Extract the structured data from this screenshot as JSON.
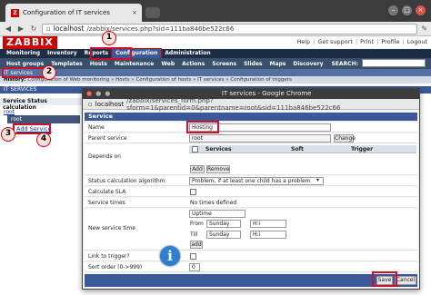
{
  "outer_browser": {
    "tab_title": "Configuration of IT services",
    "url_host": "localhost",
    "url_path": "/zabbix/services.php?sid=111ba846be522c66"
  },
  "zabbix": {
    "logo": "ZABBIX",
    "top_links": [
      "Help",
      "Get support",
      "Print",
      "Profile",
      "Logout"
    ],
    "main_menu": [
      "Monitoring",
      "Inventory",
      "Reports",
      "Configuration",
      "Administration"
    ],
    "sub_menu": [
      "Host groups",
      "Templates",
      "Hosts",
      "Maintenance",
      "Web",
      "Actions",
      "Screens",
      "Slides",
      "Maps",
      "Discovery"
    ],
    "search_label": "SEARCH:",
    "it_services_label": "IT services",
    "history_label": "History:",
    "history_items": [
      "Configuration of Web monitoring",
      "Hosts",
      "Configuration of hosts",
      "IT services",
      "Configuration of triggers"
    ],
    "section_bar": "IT SERVICES",
    "svc_col_header": "Service  Status calculation",
    "root_link": "root",
    "root_row": "root",
    "add_service": "Add Service"
  },
  "popup": {
    "window_title": "IT services - Google Chrome",
    "url_host": "localhost",
    "url_path": "/zabbix/services_form.php?sform=1&parentid=0&parentname=root&sid=111ba846be522c66",
    "header": "Service",
    "fields": {
      "name_label": "Name",
      "name_value": "Hosting",
      "parent_label": "Parent service",
      "parent_value": "root",
      "change_btn": "Change",
      "depends_label": "Depends on",
      "dep_cols": [
        "Services",
        "Soft",
        "Trigger"
      ],
      "add_btn": "Add",
      "remove_btn": "Remove",
      "status_calc_label": "Status calculation algorithm",
      "status_calc_value": "Problem, if at least one child has a problem",
      "calc_sla_label": "Calculate SLA",
      "service_times_label": "Service times",
      "no_times": "No times defined",
      "new_time_label": "New service time",
      "uptime_value": "Uptime",
      "from_label": "From",
      "from_day": "Sunday",
      "from_time": "H:i",
      "till_label": "Till",
      "till_day": "Sunday",
      "till_time": "H:i",
      "add_time_btn": "add",
      "link_trigger_label": "Link to trigger?",
      "sort_label": "Sort order (0->999)",
      "sort_value": "0",
      "save_btn": "Save",
      "cancel_btn": "Cancel"
    }
  },
  "badges": [
    "1",
    "2",
    "3",
    "4"
  ],
  "info_icon": "i",
  "colors": {
    "zabbix_red": "#c00000",
    "highlight_red": "#d0102a",
    "menu_dark": "#1e2d45",
    "section_blue": "#3b5998"
  }
}
